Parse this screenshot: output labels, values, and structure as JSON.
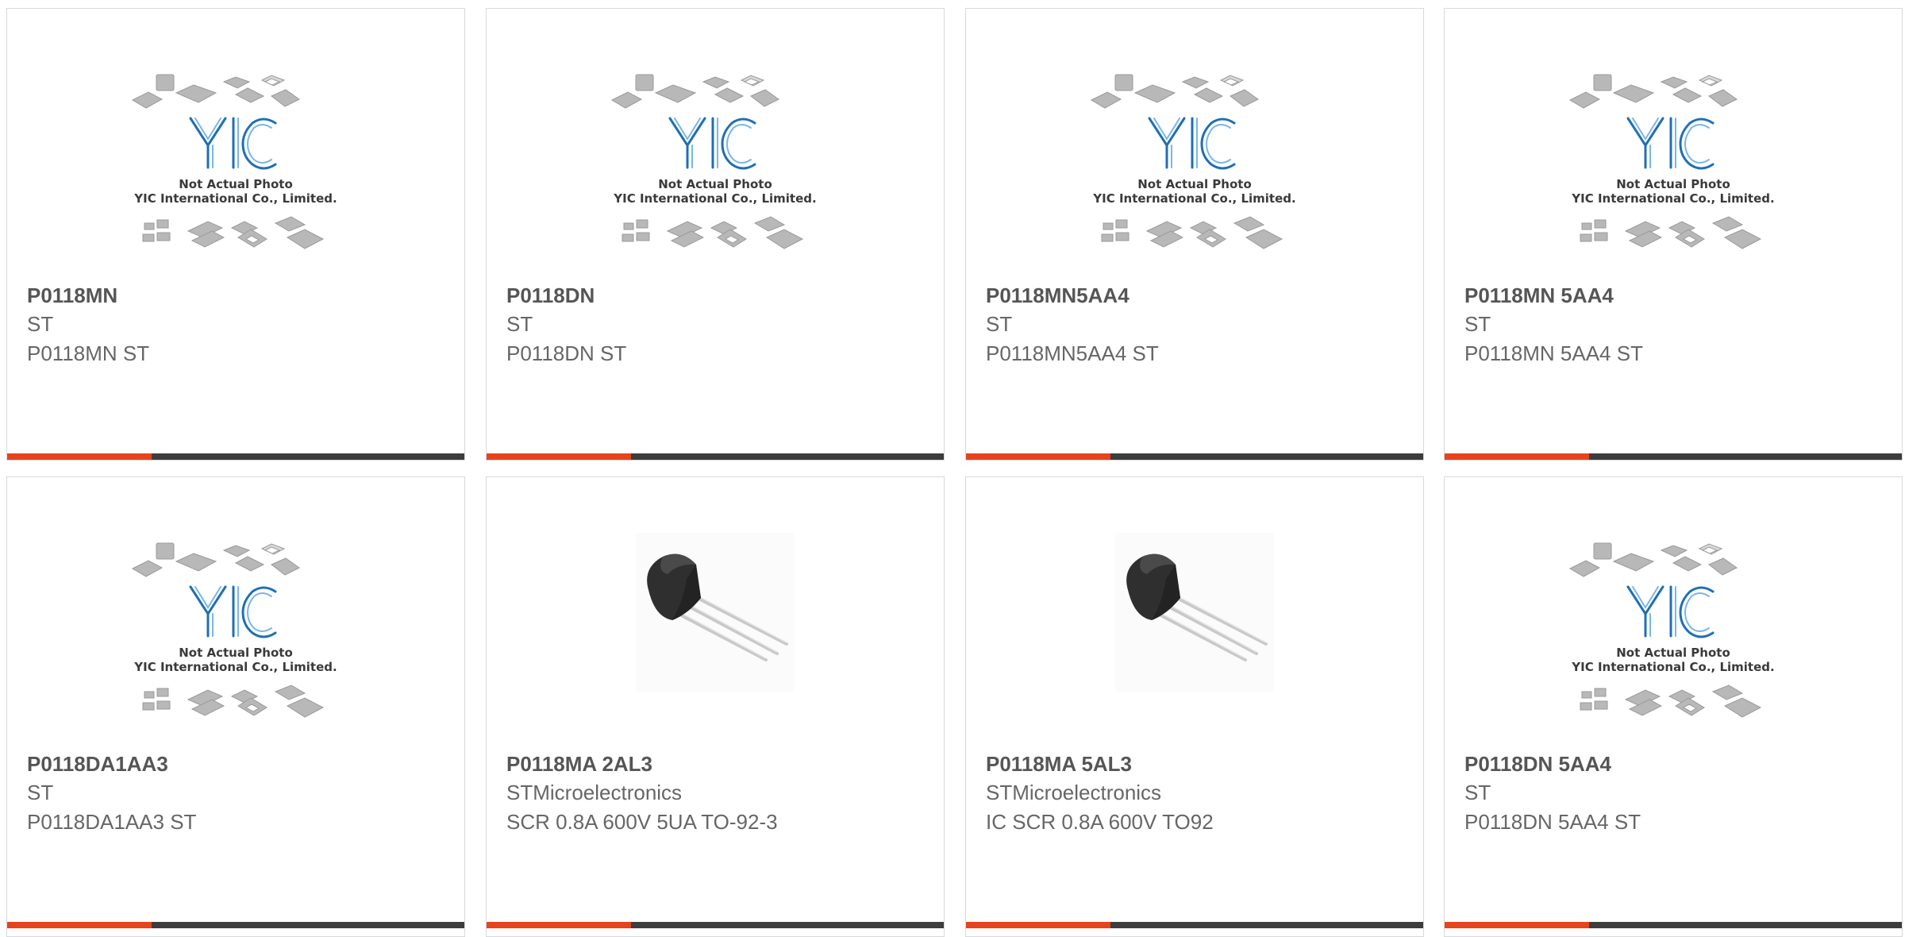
{
  "colors": {
    "accent": "#e8431c",
    "bar": "#3d3d3d",
    "logo_blue": "#1f6fb5"
  },
  "products": [
    {
      "part": "P0118MN",
      "manufacturer": "ST",
      "description": "P0118MN ST",
      "image": "placeholder",
      "logo_text": "YIC",
      "photo_note": "Not Actual Photo",
      "company": "YIC International Co., Limited."
    },
    {
      "part": "P0118DN",
      "manufacturer": "ST",
      "description": "P0118DN ST",
      "image": "placeholder",
      "logo_text": "YIC",
      "photo_note": "Not Actual Photo",
      "company": "YIC International Co., Limited."
    },
    {
      "part": "P0118MN5AA4",
      "manufacturer": "ST",
      "description": "P0118MN5AA4 ST",
      "image": "placeholder",
      "logo_text": "YIC",
      "photo_note": "Not Actual Photo",
      "company": "YIC International Co., Limited."
    },
    {
      "part": "P0118MN 5AA4",
      "manufacturer": "ST",
      "description": "P0118MN 5AA4 ST",
      "image": "placeholder",
      "logo_text": "YIC",
      "photo_note": "Not Actual Photo",
      "company": "YIC International Co., Limited."
    },
    {
      "part": "P0118DA1AA3",
      "manufacturer": "ST",
      "description": "P0118DA1AA3 ST",
      "image": "placeholder",
      "logo_text": "YIC",
      "photo_note": "Not Actual Photo",
      "company": "YIC International Co., Limited."
    },
    {
      "part": "P0118MA 2AL3",
      "manufacturer": "STMicroelectronics",
      "description": "SCR 0.8A 600V 5UA TO-92-3",
      "image": "to92"
    },
    {
      "part": "P0118MA 5AL3",
      "manufacturer": "STMicroelectronics",
      "description": "IC SCR 0.8A 600V TO92",
      "image": "to92"
    },
    {
      "part": "P0118DN 5AA4",
      "manufacturer": "ST",
      "description": "P0118DN 5AA4 ST",
      "image": "placeholder",
      "logo_text": "YIC",
      "photo_note": "Not Actual Photo",
      "company": "YIC International Co., Limited."
    }
  ]
}
